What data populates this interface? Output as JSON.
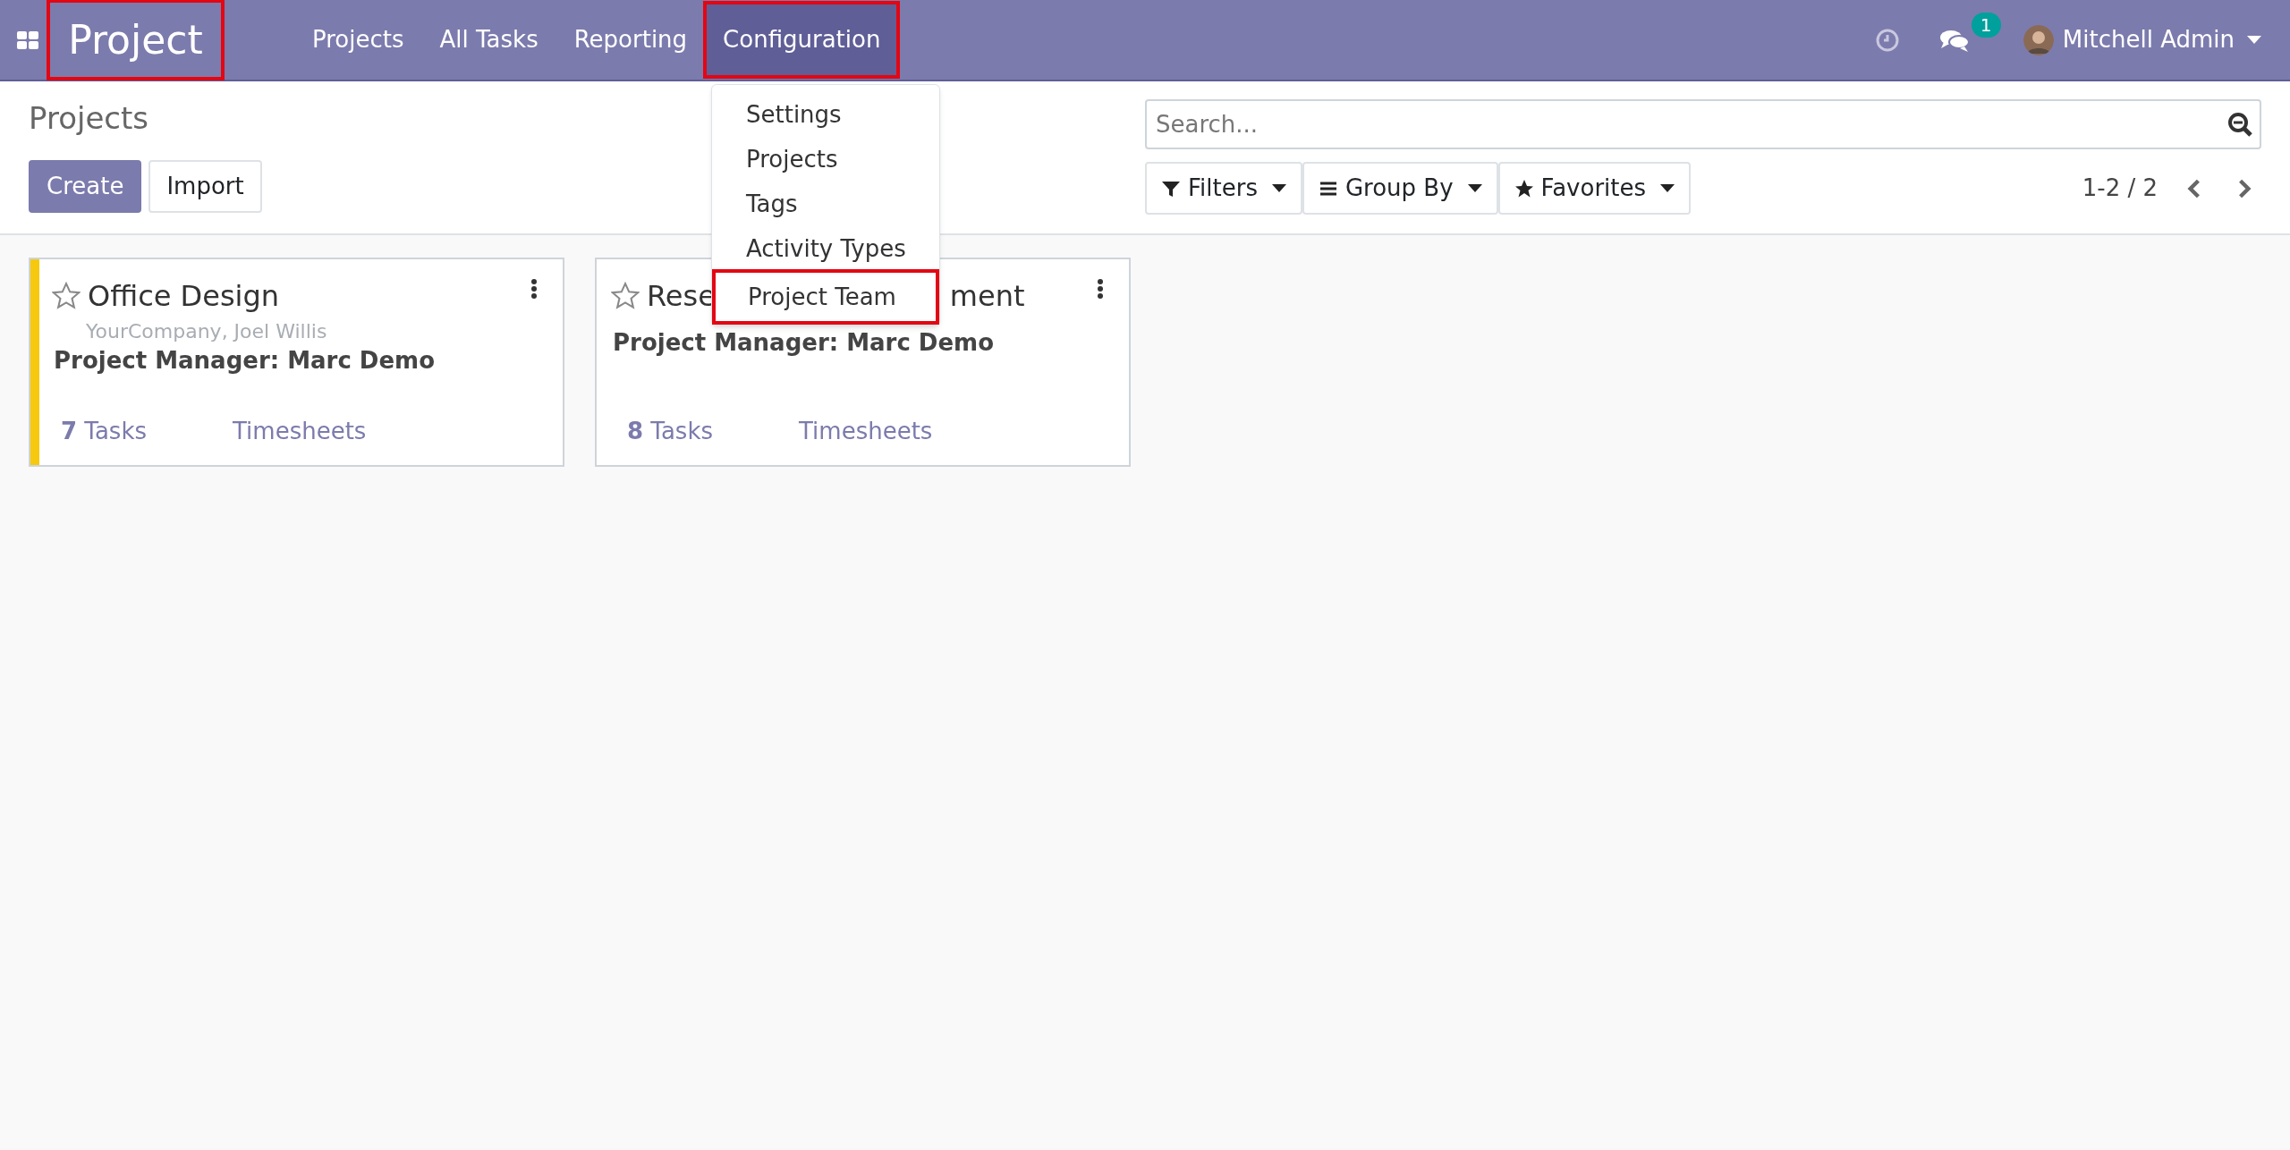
{
  "navbar": {
    "app_name": "Project",
    "app_name_highlighted": true,
    "menus": [
      {
        "label": "Projects",
        "selected": false,
        "highlighted": false
      },
      {
        "label": "All Tasks",
        "selected": false,
        "highlighted": false
      },
      {
        "label": "Reporting",
        "selected": false,
        "highlighted": false
      },
      {
        "label": "Configuration",
        "selected": true,
        "highlighted": true
      }
    ],
    "messages_count": "1",
    "user": "Mitchell Admin"
  },
  "dropdown": {
    "items": [
      {
        "label": "Settings",
        "highlighted": false
      },
      {
        "label": "Projects",
        "highlighted": false
      },
      {
        "label": "Tags",
        "highlighted": false
      },
      {
        "label": "Activity Types",
        "highlighted": false
      },
      {
        "label": "Project Team",
        "highlighted": true
      }
    ]
  },
  "control_panel": {
    "title": "Projects",
    "buttons": [
      {
        "label": "Create",
        "kind": "primary"
      },
      {
        "label": "Import",
        "kind": "secondary"
      }
    ],
    "search": {
      "placeholder": "Search..."
    },
    "filters": [
      {
        "label": "Filters",
        "kind": "filter"
      },
      {
        "label": "Group By",
        "kind": "group"
      },
      {
        "label": "Favorites",
        "kind": "favorite"
      }
    ],
    "pager": "1-2 / 2"
  },
  "cards": [
    {
      "title_start": "Office Design",
      "subtitle": "YourCompany, Joel Willis",
      "manager": "Project Manager: Marc Demo",
      "tasks": "**7** Tasks",
      "timesheets": "Timesheets",
      "favorite": false,
      "color": "#f6c90e"
    },
    {
      "title_start": "Rese",
      "title_end": "ment",
      "manager": "Project Manager: Marc Demo",
      "tasks": "**8** Tasks",
      "timesheets": "Timesheets",
      "favorite": false
    }
  ]
}
